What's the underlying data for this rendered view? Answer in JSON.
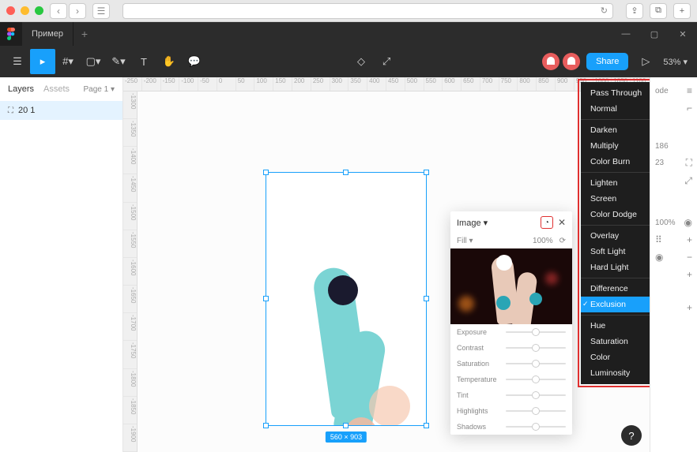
{
  "mac": {
    "reload_icon": "↻",
    "share_icon": "⇪",
    "tabs_icon": "⧉",
    "plus_icon": "+"
  },
  "tabs": {
    "file_name": "Пример",
    "add": "+"
  },
  "toolbar": {
    "share_label": "Share",
    "zoom": "53% ▾",
    "play_icon": "▷"
  },
  "left": {
    "tab_layers": "Layers",
    "tab_assets": "Assets",
    "page": "Page 1 ▾",
    "layer": {
      "icon": "⛶",
      "name": "20 1"
    }
  },
  "ruler_h": [
    "-250",
    "-200",
    "-150",
    "-100",
    "-50",
    "0",
    "50",
    "100",
    "150",
    "200",
    "250",
    "300",
    "350",
    "400",
    "450",
    "500",
    "550",
    "600",
    "650",
    "700",
    "750",
    "800",
    "850",
    "900",
    "950",
    "1000",
    "1050",
    "1100"
  ],
  "ruler_v": [
    "-1300",
    "-1350",
    "-1400",
    "-1450",
    "-1500",
    "-1550",
    "-1600",
    "-1650",
    "-1700",
    "-1750",
    "-1800",
    "-1850",
    "-1900"
  ],
  "frame": {
    "dim": "560 × 903"
  },
  "popover": {
    "title": "Image ▾",
    "droplet": "◔",
    "close": "✕",
    "fill_label": "Fill ▾",
    "fill_value": "100%",
    "rotate_icon": "⟳",
    "sliders": [
      "Exposure",
      "Contrast",
      "Saturation",
      "Temperature",
      "Tint",
      "Highlights",
      "Shadows"
    ]
  },
  "blend_modes": {
    "groups": [
      [
        "Pass Through",
        "Normal"
      ],
      [
        "Darken",
        "Multiply",
        "Color Burn"
      ],
      [
        "Lighten",
        "Screen",
        "Color Dodge"
      ],
      [
        "Overlay",
        "Soft Light",
        "Hard Light"
      ],
      [
        "Difference",
        "Exclusion"
      ],
      [
        "Hue",
        "Saturation",
        "Color",
        "Luminosity"
      ]
    ],
    "selected": "Exclusion"
  },
  "right": {
    "tab_partial": "ode",
    "val1": "186",
    "val2": "23",
    "opacity": "100%",
    "align_ic": "≡",
    "corner_ic": "⌐",
    "frame_ic": "⛶",
    "expand_ic": "⤢",
    "eye": "◉",
    "dots": "⠿",
    "plus": "+",
    "minus": "−"
  },
  "help": "?"
}
